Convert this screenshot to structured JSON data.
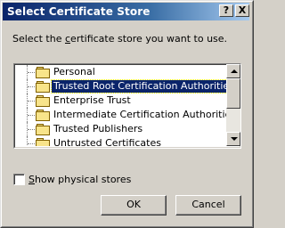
{
  "window": {
    "title": "Select Certificate Store"
  },
  "titlebar": {
    "help_label": "?",
    "close_label": "X"
  },
  "instruction": {
    "before": "Select the ",
    "accel": "c",
    "after": "ertificate store you want to use."
  },
  "tree": {
    "items": [
      {
        "label": "Personal",
        "selected": false
      },
      {
        "label": "Trusted Root Certification Authorities",
        "selected": true
      },
      {
        "label": "Enterprise Trust",
        "selected": false
      },
      {
        "label": "Intermediate Certification Authorities",
        "selected": false
      },
      {
        "label": "Trusted Publishers",
        "selected": false
      },
      {
        "label": "Untrusted Certificates",
        "selected": false
      }
    ]
  },
  "checkbox": {
    "accel": "S",
    "rest": "how physical stores",
    "checked": false
  },
  "buttons": {
    "ok_label": "OK",
    "cancel_label": "Cancel"
  }
}
